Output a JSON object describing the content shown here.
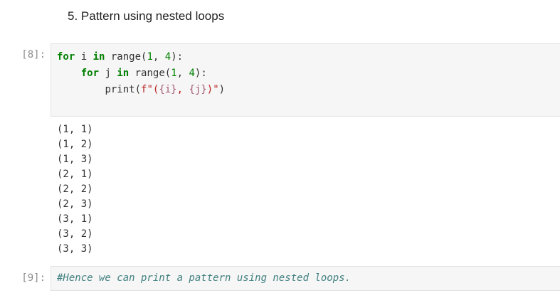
{
  "markdown": {
    "heading": "5. Pattern using nested loops"
  },
  "cells": [
    {
      "prompt": "[8]:",
      "code": {
        "l1": {
          "kw": "for",
          "mid1": " i ",
          "kw2": "in",
          "mid2": " range(",
          "n1": "1",
          "sep": ", ",
          "n2": "4",
          "end": "):"
        },
        "l2": {
          "indent": "    ",
          "kw": "for",
          "mid1": " j ",
          "kw2": "in",
          "mid2": " range(",
          "n1": "1",
          "sep": ", ",
          "n2": "4",
          "end": "):"
        },
        "l3": {
          "indent": "        ",
          "pre": "print(",
          "s1": "f\"(",
          "v1": "{i}",
          "s2": ", ",
          "v2": "{j}",
          "s3": ")\"",
          "post": ")"
        }
      },
      "output": [
        "(1, 1)",
        "(1, 2)",
        "(1, 3)",
        "(2, 1)",
        "(2, 2)",
        "(2, 3)",
        "(3, 1)",
        "(3, 2)",
        "(3, 3)"
      ]
    },
    {
      "prompt": "[9]:",
      "comment": "#Hence we can print a pattern using nested loops."
    }
  ]
}
